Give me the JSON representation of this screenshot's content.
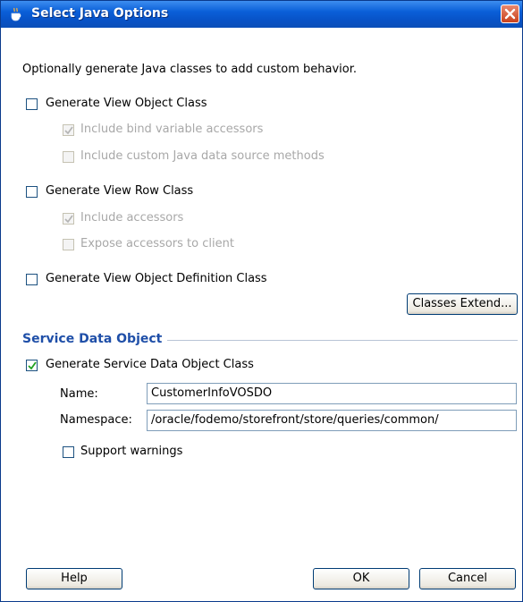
{
  "window": {
    "title": "Select Java Options"
  },
  "intro_text": "Optionally generate Java classes to add custom behavior.",
  "options": {
    "view_object_class": {
      "label": "Generate View Object Class",
      "checked": false
    },
    "bind_variable_accessors": {
      "label": "Include bind variable accessors",
      "checked": true,
      "disabled": true
    },
    "custom_java_data_source": {
      "label": "Include custom Java data source methods",
      "checked": false,
      "disabled": true
    },
    "view_row_class": {
      "label": "Generate View Row Class",
      "checked": false
    },
    "include_accessors": {
      "label": "Include accessors",
      "checked": true,
      "disabled": true
    },
    "expose_accessors": {
      "label": "Expose accessors to client",
      "checked": false,
      "disabled": true
    },
    "view_object_definition_class": {
      "label": "Generate View Object Definition Class",
      "checked": false
    }
  },
  "classes_extend_button": "Classes Extend...",
  "sdo": {
    "section_title": "Service Data Object",
    "generate": {
      "label": "Generate Service Data Object Class",
      "checked": true
    },
    "name_label": "Name:",
    "name_value": "CustomerInfoVOSDO",
    "namespace_label": "Namespace:",
    "namespace_value": "/oracle/fodemo/storefront/store/queries/common/",
    "support_warnings": {
      "label": "Support warnings",
      "checked": false
    }
  },
  "buttons": {
    "help": "Help",
    "ok": "OK",
    "cancel": "Cancel"
  },
  "colors": {
    "titlebar": "#0a5fd8",
    "section_title": "#1f4fa8",
    "close": "#c9411c"
  }
}
